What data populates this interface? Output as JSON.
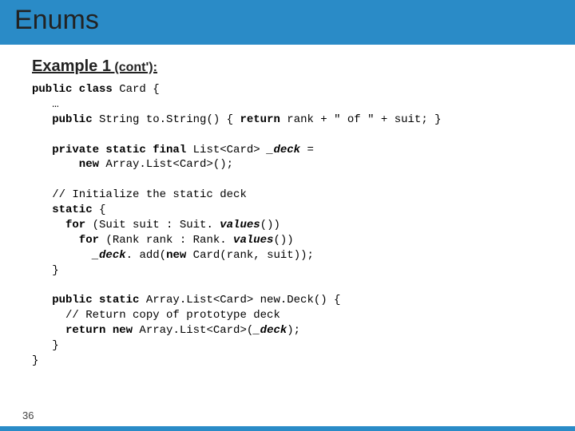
{
  "header": {
    "title": "Enums"
  },
  "subtitle": {
    "main": "Example 1",
    "cont": " (cont'):"
  },
  "code": {
    "l1a": "public class",
    "l1b": " Card {",
    "l2": "   …",
    "l3a": "   public",
    "l3b": " String to.String() { ",
    "l3c": "return",
    "l3d": " rank + \" of \" + suit; }",
    "blank1": "",
    "l4a": "   private static final",
    "l4b": " List<Card> ",
    "l4c": "_deck",
    "l4d": " =",
    "l5a": "       new",
    "l5b": " Array.List<Card>();",
    "blank2": "",
    "l6": "   // Initialize the static deck",
    "l7a": "   static",
    "l7b": " {",
    "l8a": "     for",
    "l8b": " (Suit suit : Suit. ",
    "l8c": "values",
    "l8d": "())",
    "l9a": "       for",
    "l9b": " (Rank rank : Rank. ",
    "l9c": "values",
    "l9d": "())",
    "l10a": "         ",
    "l10b": "_deck",
    "l10c": ". add(",
    "l10d": "new",
    "l10e": " Card(rank, suit));",
    "l11": "   }",
    "blank3": "",
    "l12a": "   public static",
    "l12b": " Array.List<Card> new.Deck() {",
    "l13": "     // Return copy of prototype deck",
    "l14a": "     return new",
    "l14b": " Array.List<Card>(",
    "l14c": "_deck",
    "l14d": ");",
    "l15": "   }",
    "l16": "}"
  },
  "footer": {
    "slide_number": "36"
  }
}
